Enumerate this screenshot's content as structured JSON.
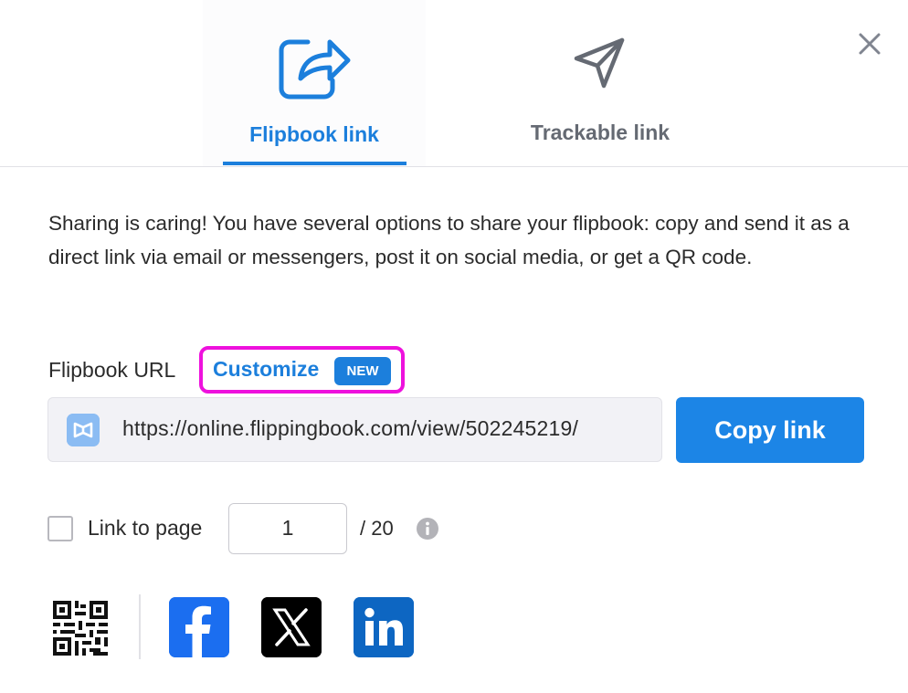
{
  "tabs": [
    {
      "label": "Flipbook link",
      "icon": "share-arrow-icon",
      "active": true
    },
    {
      "label": "Trackable link",
      "icon": "paper-plane-icon",
      "active": false
    }
  ],
  "description": "Sharing is caring! You have several options to share your flipbook: copy and send it as a direct link via email or messengers, post it on social media, or get a QR code.",
  "url_section": {
    "label": "Flipbook URL",
    "customize_label": "Customize",
    "new_badge": "NEW",
    "url_value": "https://online.flippingbook.com/view/502245219/",
    "copy_button": "Copy link"
  },
  "link_to_page": {
    "label": "Link to page",
    "checked": false,
    "page_value": "1",
    "total_pages": "/ 20"
  },
  "share_icons": [
    "qr-code-icon",
    "facebook-icon",
    "x-icon",
    "linkedin-icon"
  ],
  "colors": {
    "accent": "#1c7fdc",
    "highlight": "#ee11dd",
    "facebook": "#1b6ef0",
    "linkedin": "#0d66c2"
  }
}
